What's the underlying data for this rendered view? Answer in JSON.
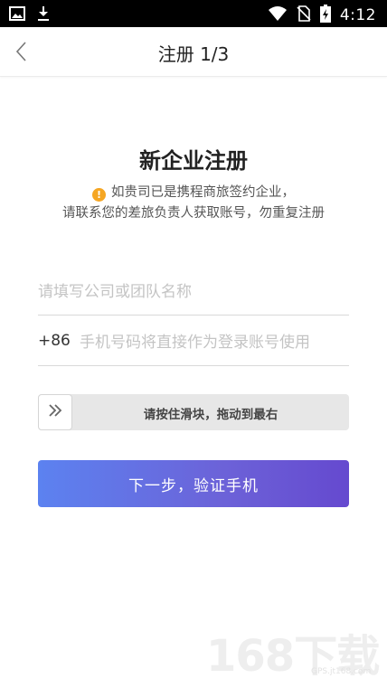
{
  "status_bar": {
    "time": "4:12",
    "left_icons": [
      "image-icon",
      "download-icon"
    ],
    "right_icons": [
      "wifi-icon",
      "no-sim-icon",
      "battery-charging-icon"
    ]
  },
  "nav": {
    "back_icon": "chevron-left-icon",
    "title": "注册 1/3"
  },
  "form": {
    "heading": "新企业注册",
    "notice_line1": "如贵司已是携程商旅签约企业，",
    "notice_line2": "请联系您的差旅负责人获取账号，勿重复注册",
    "company_placeholder": "请填写公司或团队名称",
    "country_code": "+86",
    "phone_placeholder": "手机号码将直接作为登录账号使用",
    "slider_text": "请按住滑块，拖动到最右",
    "next_label": "下一步，验证手机"
  },
  "watermark": {
    "text": "168下载",
    "sub": "GPS.jt168.com"
  },
  "colors": {
    "button_gradient_start": "#5c82f0",
    "button_gradient_end": "#6549cf",
    "warning": "#f5a623"
  }
}
